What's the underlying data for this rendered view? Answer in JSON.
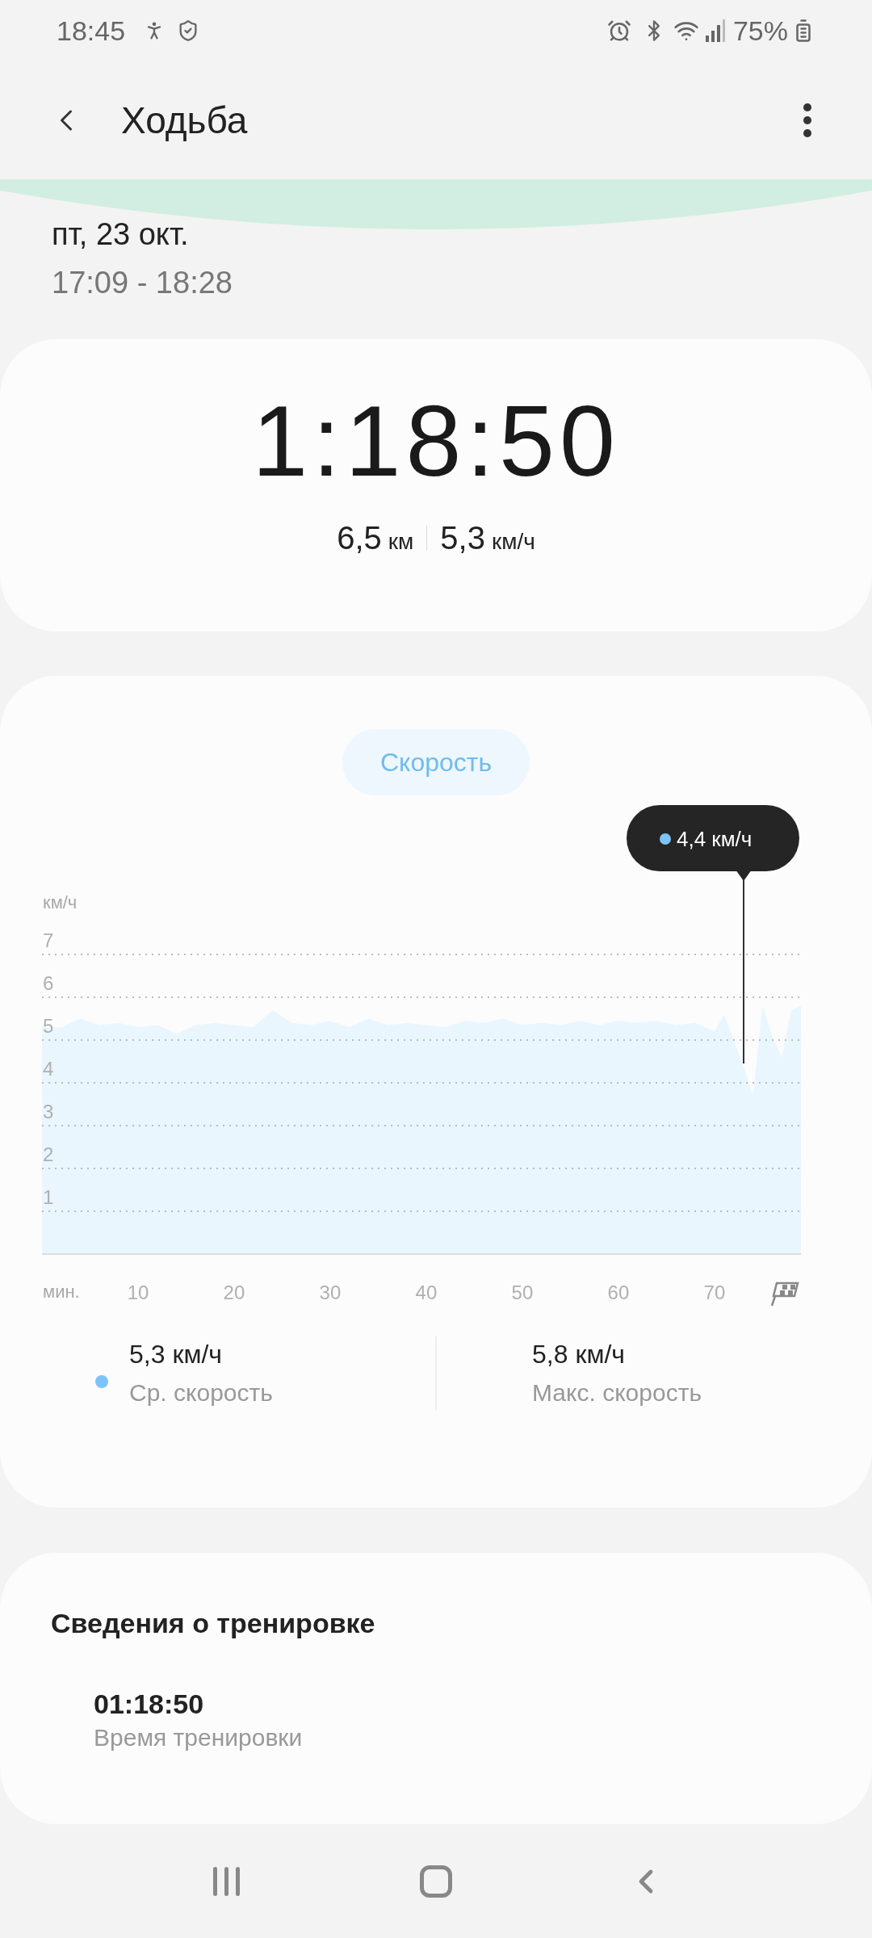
{
  "status_bar": {
    "time": "18:45",
    "battery": "75%"
  },
  "header": {
    "title": "Ходьба"
  },
  "session": {
    "date": "пт, 23 окт.",
    "time_range": "17:09 - 18:28"
  },
  "summary": {
    "duration": "1:18:50",
    "distance": {
      "value": "6,5",
      "unit": "км"
    },
    "avg_speed": {
      "value": "5,3",
      "unit": "км/ч"
    }
  },
  "speed_card": {
    "tab": {
      "label": "Скорость",
      "selected": true
    },
    "chart_data": {
      "type": "area",
      "xlabel": "мин.",
      "ylabel": "км/ч",
      "xlim": [
        0,
        79
      ],
      "ylim": [
        0,
        7
      ],
      "xticks": [
        10,
        20,
        30,
        40,
        50,
        60,
        70
      ],
      "yticks": [
        1,
        2,
        3,
        4,
        5,
        6,
        7
      ],
      "x": [
        0,
        2,
        4,
        6,
        8,
        10,
        12,
        14,
        16,
        18,
        20,
        22,
        24,
        26,
        28,
        30,
        32,
        34,
        36,
        38,
        40,
        42,
        44,
        46,
        48,
        50,
        52,
        54,
        56,
        58,
        60,
        62,
        64,
        66,
        68,
        70,
        71,
        72,
        73,
        74,
        75,
        76,
        77,
        78,
        79
      ],
      "series": [
        {
          "color": "#e9f6fe",
          "values": [
            5.3,
            5.3,
            5.5,
            5.35,
            5.4,
            5.3,
            5.35,
            5.15,
            5.35,
            5.4,
            5.35,
            5.3,
            5.7,
            5.4,
            5.35,
            5.45,
            5.3,
            5.5,
            5.35,
            5.4,
            5.35,
            5.3,
            5.45,
            5.4,
            5.5,
            5.35,
            5.4,
            5.35,
            5.45,
            5.35,
            5.45,
            5.4,
            5.45,
            5.35,
            5.4,
            5.2,
            5.6,
            5.0,
            4.4,
            3.7,
            5.8,
            5.1,
            4.6,
            5.7,
            5.8
          ]
        }
      ],
      "grid": true,
      "annotations": [
        "4,4 км/ч"
      ]
    },
    "stats": [
      {
        "value": "5,3 км/ч",
        "label": "Ср. скорость",
        "color": "#7cc4fa"
      },
      {
        "value": "5,8 км/ч",
        "label": "Макс. скорость"
      }
    ]
  },
  "details": {
    "title": "Сведения о тренировке",
    "items": [
      {
        "value": "01:18:50",
        "label": "Время тренировки"
      }
    ]
  }
}
